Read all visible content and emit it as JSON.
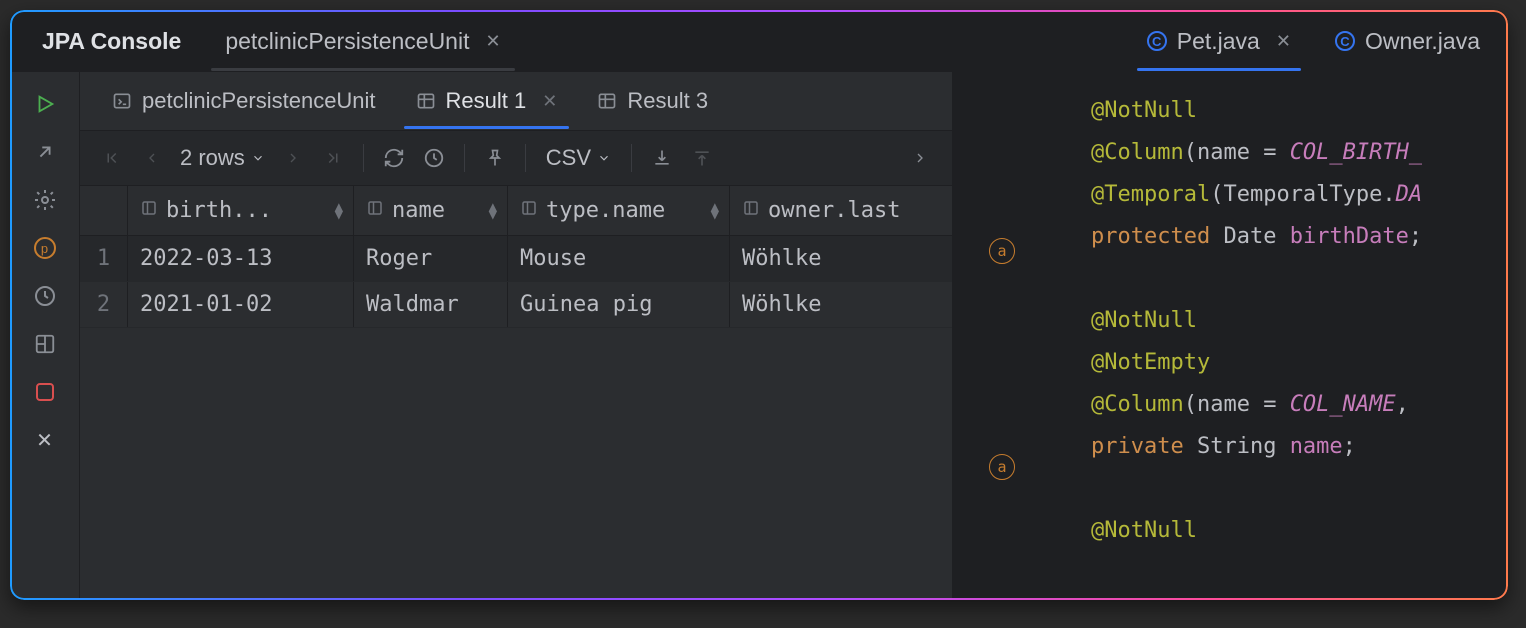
{
  "tabs": {
    "console": "JPA Console",
    "persistence": "petclinicPersistenceUnit",
    "pet": "Pet.java",
    "owner": "Owner.java"
  },
  "inner_tabs": {
    "persistence": "petclinicPersistenceUnit",
    "result1": "Result 1",
    "result3": "Result 3"
  },
  "toolbar": {
    "row_count": "2 rows",
    "format": "CSV"
  },
  "columns": {
    "birth": "birth...",
    "name": "name",
    "type": "type.name",
    "owner": "owner.last"
  },
  "rows": [
    {
      "idx": "1",
      "birth": "2022-03-13",
      "name": "Roger",
      "type": "Mouse",
      "owner": "Wöhlke"
    },
    {
      "idx": "2",
      "birth": "2021-01-02",
      "name": "Waldmar",
      "type": "Guinea pig",
      "owner": "Wöhlke"
    }
  ],
  "code": {
    "l1": "@NotNull",
    "l2a": "@Column",
    "l2b": "(name = ",
    "l2c": "COL_BIRTH_",
    "l3a": "@Temporal",
    "l3b": "(TemporalType.",
    "l3c": "DA",
    "l4a": "protected",
    "l4b": " Date ",
    "l4c": "birthDate",
    "l4d": ";",
    "l5": "",
    "l6": "@NotNull",
    "l7": "@NotEmpty",
    "l8a": "@Column",
    "l8b": "(name = ",
    "l8c": "COL_NAME",
    "l8d": ",",
    "l9a": "private",
    "l9b": " String ",
    "l9c": "name",
    "l9d": ";",
    "l10": "",
    "l11": "@NotNull"
  }
}
